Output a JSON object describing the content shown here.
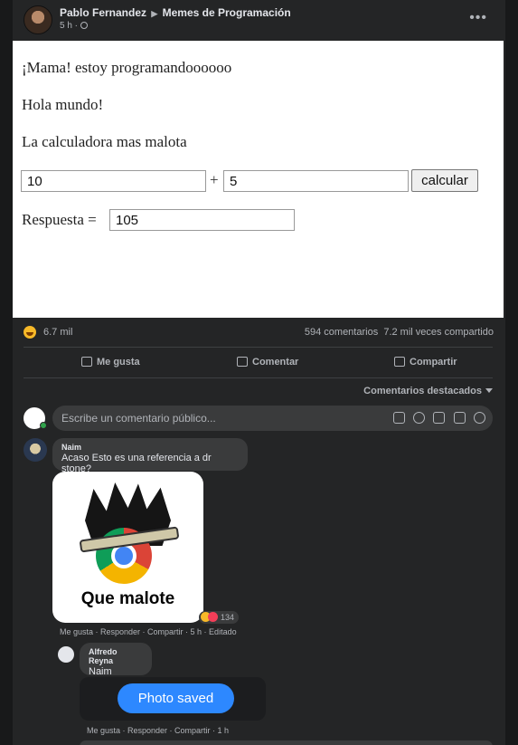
{
  "post": {
    "author": "Pablo Fernandez",
    "group": "Memes de Programación",
    "time": "5 h",
    "image": {
      "line1": "¡Mama! estoy programandoooooo",
      "line2": "Hola mundo!",
      "line3": "La calculadora mas malota",
      "input_a": "10",
      "operator": "+",
      "input_b": "5",
      "button": "calcular",
      "result_label": "Respuesta =",
      "result_value": "105"
    },
    "stats": {
      "reactions": "6.7 mil",
      "comments": "594 comentarios",
      "shares": "7.2 mil veces compartido"
    },
    "actions": {
      "like": "Me gusta",
      "comment": "Comentar",
      "share": "Compartir"
    },
    "sort_label": "Comentarios destacados",
    "compose_placeholder": "Escribe un comentario público..."
  },
  "comments": [
    {
      "author": "Naim",
      "text": "Acaso Esto es una referencia a dr stone?",
      "meme_caption": "Que malote",
      "reactions": "134",
      "meta": "Me gusta · Responder · Compartir · 5 h · Editado"
    },
    {
      "author": "Alfredo Reyna",
      "text": "Naim",
      "toast": "Photo saved",
      "meta": "Me gusta · Responder · Compartir · 1 h"
    }
  ],
  "colors": {
    "background": "#18191a",
    "card": "#242526",
    "bubble": "#3a3b3c",
    "accent": "#2d88ff"
  }
}
